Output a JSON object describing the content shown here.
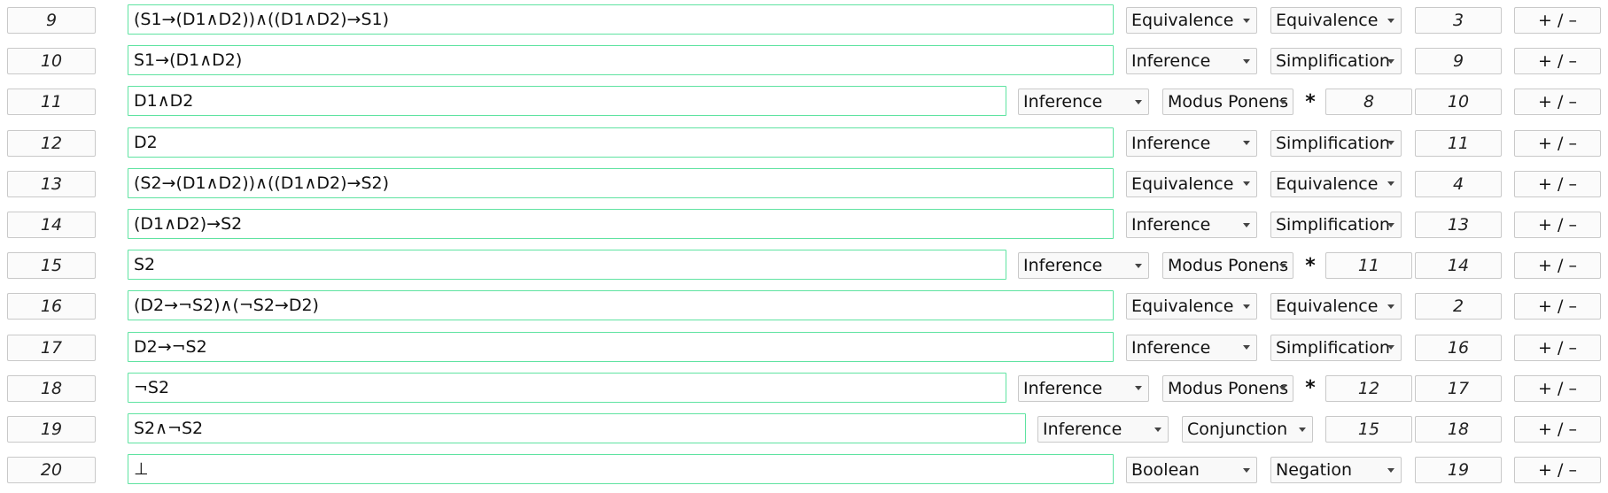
{
  "rows": [
    {
      "num": "9",
      "formula": "(S1→(D1∧D2))∧((D1∧D2)→S1)",
      "type": "Equivalence",
      "rule": "Equivalence",
      "refs": [
        "3"
      ],
      "star": "",
      "action": "+ / –",
      "layout": "long"
    },
    {
      "num": "10",
      "formula": "S1→(D1∧D2)",
      "type": "Inference",
      "rule": "Simplification",
      "refs": [
        "9"
      ],
      "star": "",
      "action": "+ / –",
      "layout": "long"
    },
    {
      "num": "11",
      "formula": "D1∧D2",
      "type": "Inference",
      "rule": "Modus Ponens",
      "refs": [
        "8",
        "10"
      ],
      "star": "*",
      "action": "+ / –",
      "layout": "star"
    },
    {
      "num": "12",
      "formula": "D2",
      "type": "Inference",
      "rule": "Simplification",
      "refs": [
        "11"
      ],
      "star": "",
      "action": "+ / –",
      "layout": "long"
    },
    {
      "num": "13",
      "formula": "(S2→(D1∧D2))∧((D1∧D2)→S2)",
      "type": "Equivalence",
      "rule": "Equivalence",
      "refs": [
        "4"
      ],
      "star": "",
      "action": "+ / –",
      "layout": "long"
    },
    {
      "num": "14",
      "formula": "(D1∧D2)→S2",
      "type": "Inference",
      "rule": "Simplification",
      "refs": [
        "13"
      ],
      "star": "",
      "action": "+ / –",
      "layout": "long"
    },
    {
      "num": "15",
      "formula": "S2",
      "type": "Inference",
      "rule": "Modus Ponens",
      "refs": [
        "11",
        "14"
      ],
      "star": "*",
      "action": "+ / –",
      "layout": "star"
    },
    {
      "num": "16",
      "formula": "(D2→¬S2)∧(¬S2→D2)",
      "type": "Equivalence",
      "rule": "Equivalence",
      "refs": [
        "2"
      ],
      "star": "",
      "action": "+ / –",
      "layout": "long"
    },
    {
      "num": "17",
      "formula": "D2→¬S2",
      "type": "Inference",
      "rule": "Simplification",
      "refs": [
        "16"
      ],
      "star": "",
      "action": "+ / –",
      "layout": "long"
    },
    {
      "num": "18",
      "formula": "¬S2",
      "type": "Inference",
      "rule": "Modus Ponens",
      "refs": [
        "12",
        "17"
      ],
      "star": "*",
      "action": "+ / –",
      "layout": "star"
    },
    {
      "num": "19",
      "formula": "S2∧¬S2",
      "type": "Inference",
      "rule": "Conjunction",
      "refs": [
        "15",
        "18"
      ],
      "star": "",
      "action": "+ / –",
      "layout": "double"
    },
    {
      "num": "20",
      "formula": "⊥",
      "type": "Boolean",
      "rule": "Negation",
      "refs": [
        "19"
      ],
      "star": "",
      "action": "+ / –",
      "layout": "long"
    }
  ],
  "colors": {
    "formula_border": "#5fe3a1",
    "box_border": "#c9c9c9",
    "background": "#ffffff"
  },
  "icons": {
    "select_arrow": "chevron-down-icon"
  }
}
